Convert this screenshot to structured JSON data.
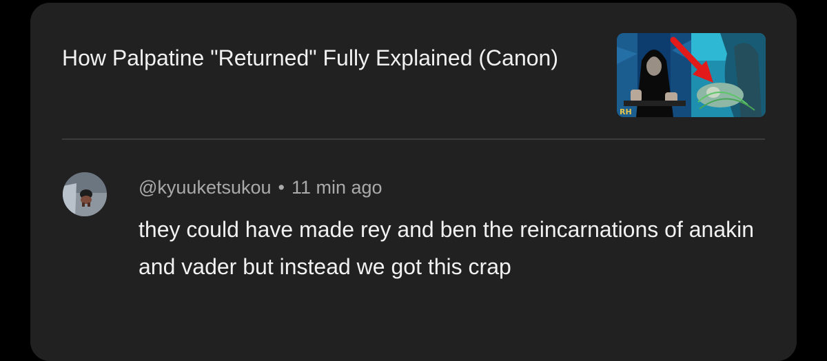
{
  "video": {
    "title": "How Palpatine \"Returned\" Fully Explained (Canon)",
    "thumbnail_icon": "video-thumbnail",
    "thumbnail_corner_text": "RH"
  },
  "comment": {
    "author": "@kyuuketsukou",
    "separator": "•",
    "time": "11 min ago",
    "text": "they could have made rey and ben the reincarnations of anakin and vader but instead we got this crap",
    "avatar_icon": "user-avatar"
  },
  "colors": {
    "page_bg": "#000000",
    "card_bg": "#212121",
    "primary_text": "#f1f1f1",
    "secondary_text": "#aaaaaa",
    "divider": "#3d3d3d",
    "arrow_red": "#e21a1a"
  }
}
